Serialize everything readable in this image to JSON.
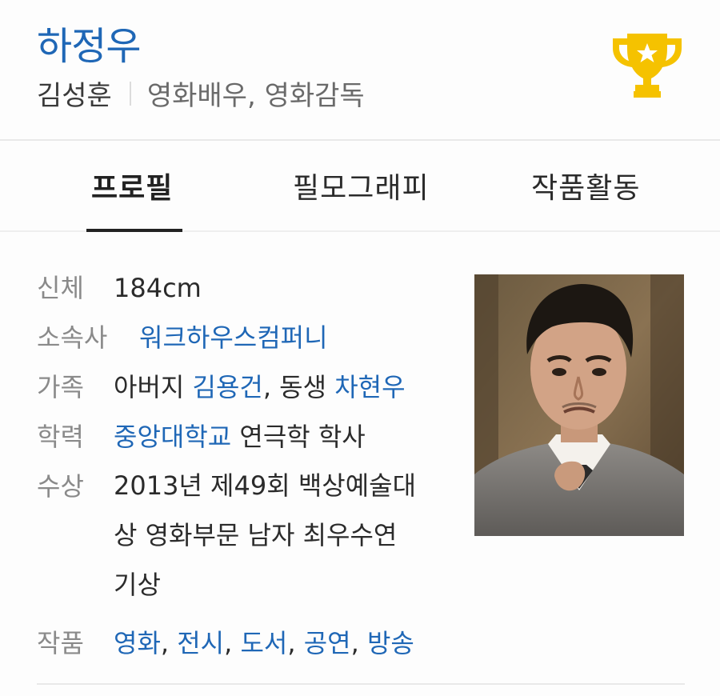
{
  "person": {
    "name": "하정우",
    "real_name": "김성훈",
    "occupation": "영화배우, 영화감독"
  },
  "tabs": [
    {
      "label": "프로필",
      "active": true
    },
    {
      "label": "필모그래피",
      "active": false
    },
    {
      "label": "작품활동",
      "active": false
    }
  ],
  "profile": {
    "body": {
      "label": "신체",
      "value": "184cm"
    },
    "agency": {
      "label": "소속사",
      "value": "워크하우스컴퍼니"
    },
    "family": {
      "label": "가족",
      "prefix1": "아버지 ",
      "name1": "김용건",
      "sep": ", 동생 ",
      "name2": "차현우"
    },
    "education": {
      "label": "학력",
      "school": "중앙대학교",
      "detail": " 연극학 학사"
    },
    "award": {
      "label": "수상",
      "line1": "2013년 제49회 백상예술대",
      "line2": "상 영화부문 남자 최우수연",
      "line3": "기상"
    },
    "works": {
      "label": "작품",
      "items": [
        "영화",
        "전시",
        "도서",
        "공연",
        "방송"
      ],
      "sep": ", "
    }
  },
  "icons": {
    "trophy": "trophy-icon",
    "trophy_color": "#f5c200"
  },
  "colors": {
    "link": "#1f67b6",
    "label": "#8a8a8a"
  }
}
